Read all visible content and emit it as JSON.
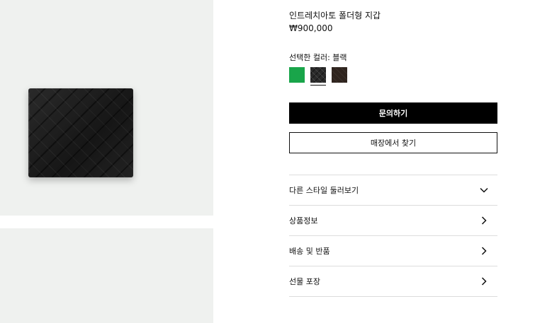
{
  "product": {
    "title": "인트레치아토 폴더형 지갑",
    "price": "₩900,000",
    "color_label": "선택한 컬러: 블랙"
  },
  "colors": {
    "green": "#19a54a",
    "black": "#2a2a2a",
    "brown": "#2f241e"
  },
  "actions": {
    "inquiry_label": "문의하기",
    "find_store_label": "매장에서 찾기"
  },
  "accordion": {
    "items": [
      {
        "label": "다른 스타일 둘러보기",
        "icon": "chevron-down-icon"
      },
      {
        "label": "상품정보",
        "icon": "chevron-right-icon"
      },
      {
        "label": "배송 및 반품",
        "icon": "chevron-right-icon"
      },
      {
        "label": "선물 포장",
        "icon": "chevron-right-icon"
      }
    ]
  }
}
